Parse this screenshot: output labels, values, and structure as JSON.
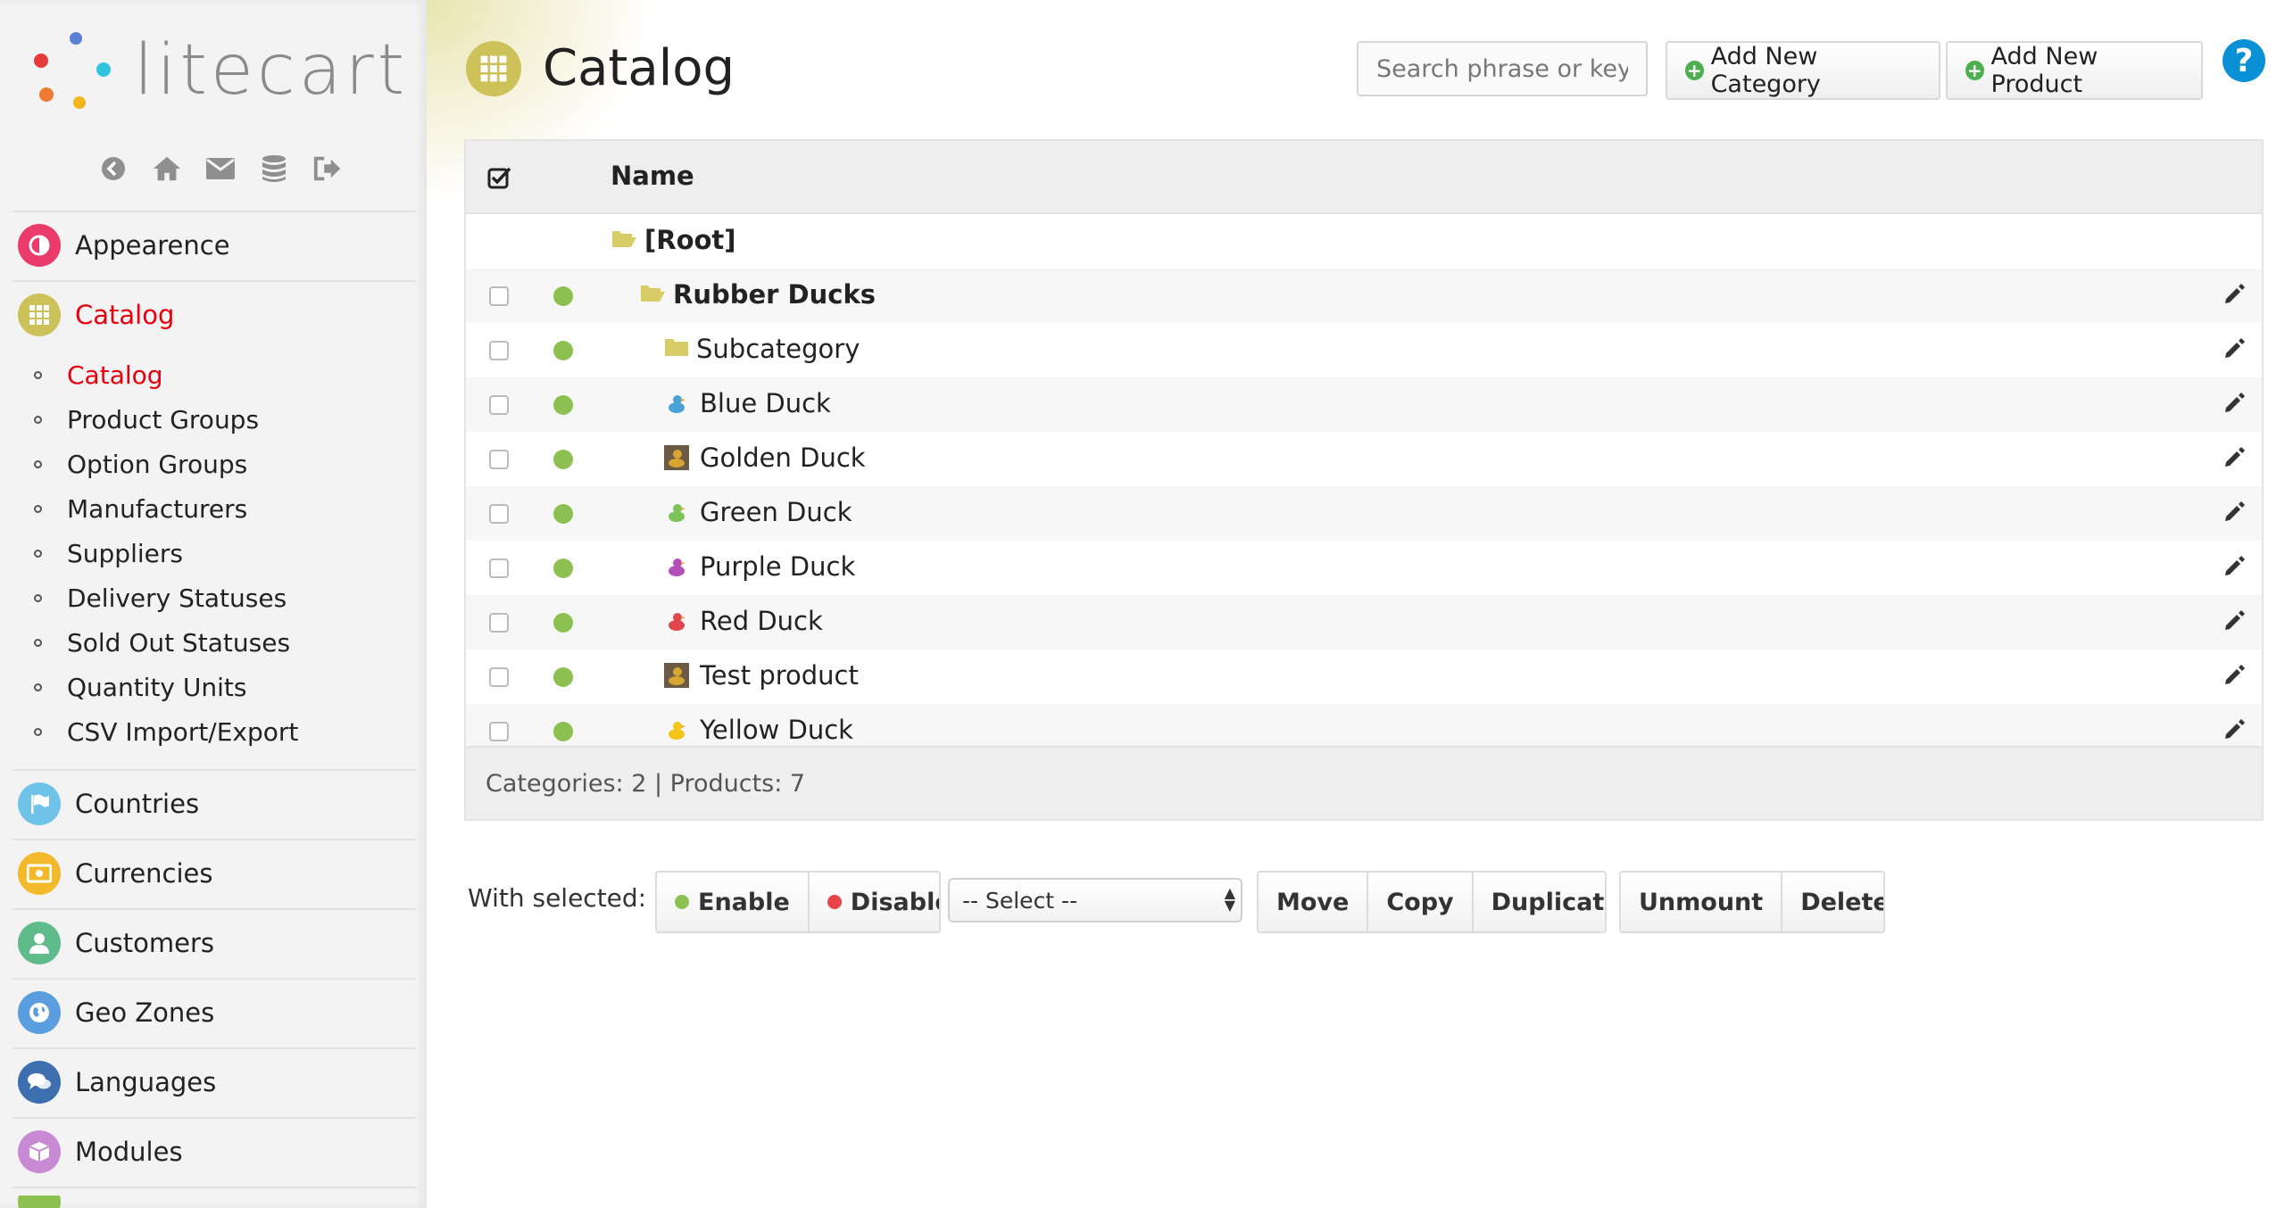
{
  "brand": {
    "name": "litecart"
  },
  "sidebar": {
    "shortcuts": [
      "back-icon",
      "home-icon",
      "mail-icon",
      "database-icon",
      "logout-icon"
    ],
    "apps_top": [
      {
        "label": "Appearence",
        "icon": "appearance-icon",
        "color": "#ea3b6b"
      },
      {
        "label": "Catalog",
        "icon": "catalog-icon",
        "color": "#cdc15a",
        "active": true
      }
    ],
    "catalog_docs": [
      {
        "label": "Catalog",
        "active": true
      },
      {
        "label": "Product Groups"
      },
      {
        "label": "Option Groups"
      },
      {
        "label": "Manufacturers"
      },
      {
        "label": "Suppliers"
      },
      {
        "label": "Delivery Statuses"
      },
      {
        "label": "Sold Out Statuses"
      },
      {
        "label": "Quantity Units"
      },
      {
        "label": "CSV Import/Export"
      }
    ],
    "apps_bottom": [
      {
        "label": "Countries",
        "icon": "flag-icon",
        "color": "#6fc3e8"
      },
      {
        "label": "Currencies",
        "icon": "money-icon",
        "color": "#f3b92c"
      },
      {
        "label": "Customers",
        "icon": "user-icon",
        "color": "#5fbb8a"
      },
      {
        "label": "Geo Zones",
        "icon": "globe-icon",
        "color": "#5a9ee0"
      },
      {
        "label": "Languages",
        "icon": "chat-icon",
        "color": "#3d6fb0"
      },
      {
        "label": "Modules",
        "icon": "cube-icon",
        "color": "#c88ad3"
      }
    ]
  },
  "header": {
    "title": "Catalog",
    "search_placeholder": "Search phrase or key",
    "add_category_label": "Add New Category",
    "add_product_label": "Add New Product",
    "help_label": "?"
  },
  "table": {
    "column_name": "Name",
    "root_label": "[Root]",
    "rows": [
      {
        "name": "Rubber Ducks",
        "type": "category-open",
        "enabled": true
      },
      {
        "name": "Subcategory",
        "type": "category",
        "enabled": true
      },
      {
        "name": "Blue Duck",
        "type": "product",
        "thumb": "#4aa3d8",
        "enabled": true
      },
      {
        "name": "Golden Duck",
        "type": "product",
        "thumb": "#6b5a44",
        "enabled": true
      },
      {
        "name": "Green Duck",
        "type": "product",
        "thumb": "#7cc45a",
        "enabled": true
      },
      {
        "name": "Purple Duck",
        "type": "product",
        "thumb": "#b44fb8",
        "enabled": true
      },
      {
        "name": "Red Duck",
        "type": "product",
        "thumb": "#e0484e",
        "enabled": true
      },
      {
        "name": "Test product",
        "type": "product",
        "thumb": "#6b5a44",
        "enabled": true
      },
      {
        "name": "Yellow Duck",
        "type": "product",
        "thumb": "#f5c518",
        "enabled": true
      }
    ],
    "footer": "Categories: 2 | Products: 7"
  },
  "actions": {
    "with_selected_label": "With selected:",
    "enable_label": "Enable",
    "disable_label": "Disable",
    "select_value": "-- Select --",
    "move_label": "Move",
    "copy_label": "Copy",
    "duplicate_label": "Duplicate",
    "unmount_label": "Unmount",
    "delete_label": "Delete"
  },
  "colors": {
    "accent_red": "#e8000e",
    "status_green": "#8cc152",
    "disable_red": "#e9434a",
    "folder_yellow": "#d8cc67"
  }
}
